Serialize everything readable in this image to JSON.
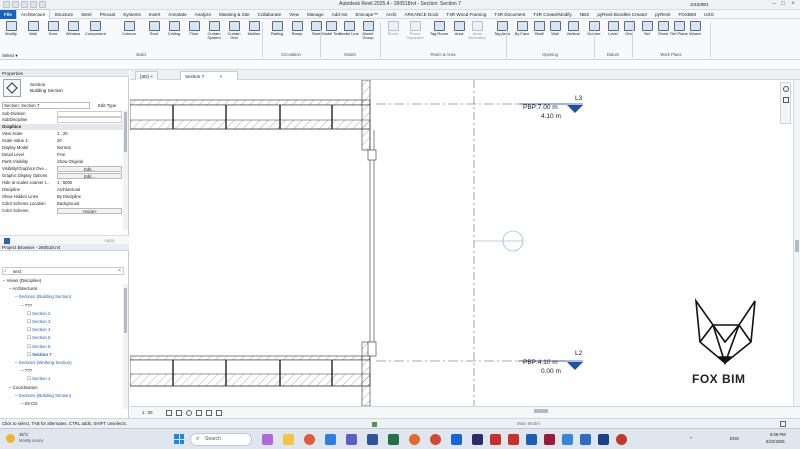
{
  "window": {
    "title": "Autodesk Revit 2025.4 - 260518rvt - Section: Section 7"
  },
  "user": {
    "name": "10153901"
  },
  "menu": [
    "File",
    "Architecture",
    "Structure",
    "Steel",
    "Precast",
    "Systems",
    "Insert",
    "Annotate",
    "Analyze",
    "Massing & Site",
    "Collaborate",
    "View",
    "Manage",
    "Add-Ins",
    "Enscape™",
    "Archi",
    "ARKANCE Dock",
    "T4R Wood Framing",
    "T4R Document",
    "T4R Create/Modify",
    "NBS",
    "pyRevit Bundles Creator",
    "pyRevit",
    "FOXBIM",
    "USG"
  ],
  "ribbon": {
    "buttons": [
      "Modify",
      "Wall",
      "Door",
      "Window",
      "Component",
      "Column",
      "Roof",
      "Ceiling",
      "Floor",
      "Curtain System",
      "Curtain Grid",
      "Mullion",
      "Railing",
      "Ramp",
      "Stair",
      "Model Text",
      "Model Line",
      "Model Group",
      "Room",
      "Room Separator",
      "Tag Room",
      "Area",
      "Area Boundary",
      "Tag Area",
      "By Face",
      "Shaft",
      "Wall",
      "Vertical",
      "Dormer",
      "Level",
      "Grid",
      "Set",
      "Show",
      "Ref Plane",
      "Viewer"
    ],
    "groups": [
      "Select",
      "Build",
      "Circulation",
      "Model",
      "Room & Area",
      "Opening",
      "Datum",
      "Work Plane"
    ],
    "select_label": "Select ▾"
  },
  "properties": {
    "header": "Properties",
    "type_name": "Section",
    "type_sub": "Building Section",
    "selector": "Section: Section 7",
    "edit_type": "Edit Type",
    "rows_top": [
      {
        "k": "Sub-Division",
        "v": ""
      },
      {
        "k": "SubDiscipline",
        "v": ""
      }
    ],
    "graphics_label": "Graphics",
    "rows": [
      {
        "k": "View Scale",
        "v": "1 : 20"
      },
      {
        "k": "Scale Value 1:",
        "v": "20"
      },
      {
        "k": "Display Model",
        "v": "Normal"
      },
      {
        "k": "Detail Level",
        "v": "Fine"
      },
      {
        "k": "Parts Visibility",
        "v": "Show Original"
      },
      {
        "k": "Visibility/Graphics Ove...",
        "v": "Edit..."
      },
      {
        "k": "Graphic Display Options",
        "v": "Edit..."
      },
      {
        "k": "Hide at scales coarser t...",
        "v": "1 : 5000"
      },
      {
        "k": "Discipline",
        "v": "Architectural"
      },
      {
        "k": "Show Hidden Lines",
        "v": "By Discipline"
      },
      {
        "k": "Color Scheme Location",
        "v": "Background"
      },
      {
        "k": "Color Scheme",
        "v": "<none>"
      }
    ],
    "apply": "Apply"
  },
  "browser": {
    "header": "Project Browser - 260518.rvt",
    "search": "sect",
    "items": [
      {
        "t": "Views (Discipline)",
        "d": 0
      },
      {
        "t": "Architectural",
        "d": 1
      },
      {
        "t": "Sections (Building Section)",
        "d": 2
      },
      {
        "t": "???",
        "d": 3
      },
      {
        "t": "Section 2",
        "d": 4
      },
      {
        "t": "Section 3",
        "d": 4
      },
      {
        "t": "Section 4",
        "d": 4
      },
      {
        "t": "Section 5",
        "d": 4
      },
      {
        "t": "Section 6",
        "d": 4
      },
      {
        "t": "Section 7",
        "d": 4,
        "bold": true
      },
      {
        "t": "Sections (Working Section)",
        "d": 2
      },
      {
        "t": "???",
        "d": 3
      },
      {
        "t": "Section 1",
        "d": 4
      },
      {
        "t": "Coordination",
        "d": 1
      },
      {
        "t": "Sections (Building Section)",
        "d": 2
      },
      {
        "t": "03-CD",
        "d": 3
      }
    ]
  },
  "doc_tabs": [
    {
      "label": "{3D}"
    },
    {
      "label": "Section 7",
      "active": true
    }
  ],
  "levels": [
    {
      "name": "L3",
      "elev_label": "PBP:7.00 m",
      "elev": "4.10 m"
    },
    {
      "name": "L2",
      "elev_label": "PBP:4.10 m",
      "elev": "0.00 m"
    }
  ],
  "logo": {
    "text": "FOX BIM"
  },
  "viewbar": {
    "scale": "1 : 20"
  },
  "status": {
    "hint": "Click to select, TAB for alternates, CTRL adds, SHIFT unselects.",
    "model": "Main Model"
  },
  "taskbar": {
    "weather_temp": "15°C",
    "weather_text": "Mostly sunny",
    "search": "Search",
    "lang": "ENG",
    "time": "6:08 PM",
    "date": "5/22/2026"
  },
  "colors": {
    "accent": "#1565c0",
    "level_marker": "#1f4fa8"
  }
}
